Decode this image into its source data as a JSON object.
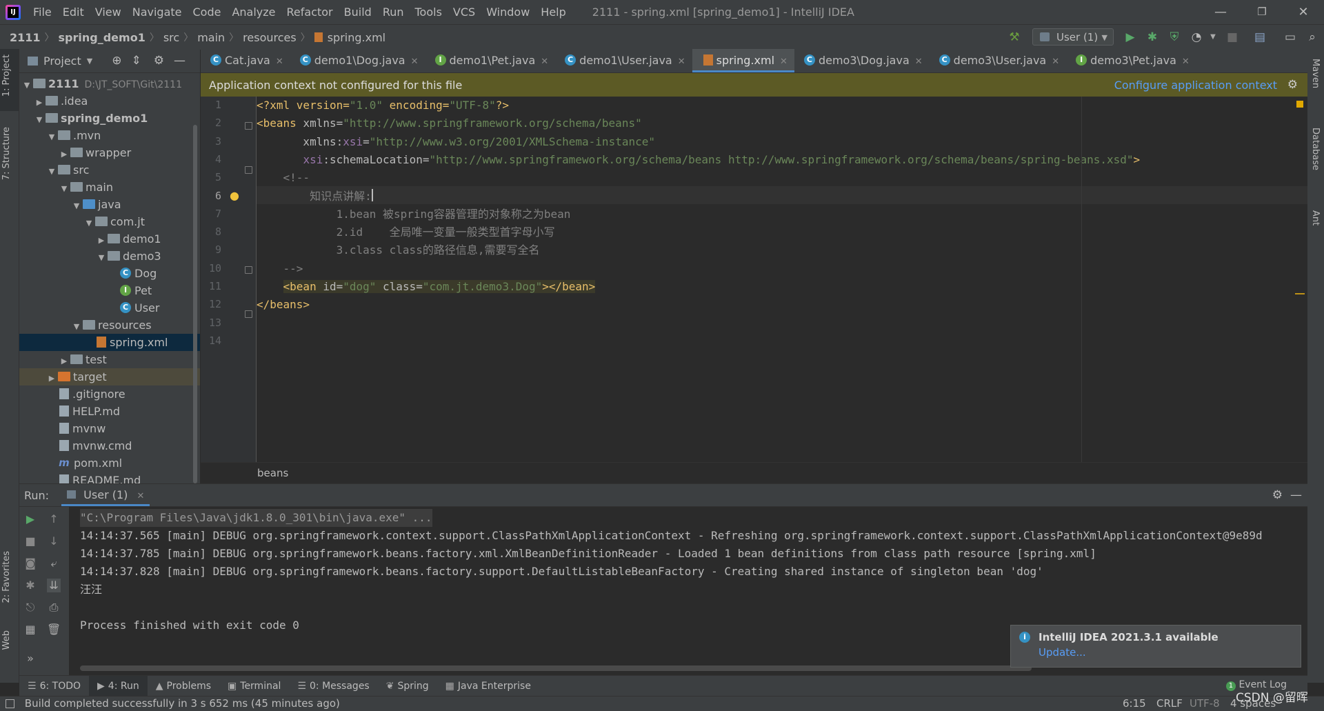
{
  "window": {
    "title": "2111 - spring.xml [spring_demo1] - IntelliJ IDEA",
    "menu": [
      "File",
      "Edit",
      "View",
      "Navigate",
      "Code",
      "Analyze",
      "Refactor",
      "Build",
      "Run",
      "Tools",
      "VCS",
      "Window",
      "Help"
    ],
    "min_glyph": "—",
    "max_glyph": "❐",
    "close_glyph": "✕"
  },
  "nav": {
    "crumbs": [
      "2111",
      "spring_demo1",
      "src",
      "main",
      "resources",
      "spring.xml"
    ],
    "run_config": "User (1)"
  },
  "left_stripe": {
    "project": "1: Project",
    "structure": "7: Structure",
    "favorites": "2: Favorites",
    "web": "Web"
  },
  "right_stripe": {
    "maven": "Maven",
    "database": "Database",
    "ant": "Ant"
  },
  "project": {
    "title": "Project",
    "tree": [
      {
        "label": "2111",
        "extra": "D:\\JT_SOFT\\Git\\2111",
        "depth": 0,
        "arrow": "▼",
        "icon": "folder",
        "bold": true
      },
      {
        "label": ".idea",
        "depth": 1,
        "arrow": "▶",
        "icon": "folder"
      },
      {
        "label": "spring_demo1",
        "depth": 1,
        "arrow": "▼",
        "icon": "folder",
        "bold": true
      },
      {
        "label": ".mvn",
        "depth": 2,
        "arrow": "▼",
        "icon": "folder"
      },
      {
        "label": "wrapper",
        "depth": 3,
        "arrow": "▶",
        "icon": "folder"
      },
      {
        "label": "src",
        "depth": 2,
        "arrow": "▼",
        "icon": "folder"
      },
      {
        "label": "main",
        "depth": 3,
        "arrow": "▼",
        "icon": "folder"
      },
      {
        "label": "java",
        "depth": 4,
        "arrow": "▼",
        "icon": "folder-blue"
      },
      {
        "label": "com.jt",
        "depth": 5,
        "arrow": "▼",
        "icon": "folder"
      },
      {
        "label": "demo1",
        "depth": 6,
        "arrow": "▶",
        "icon": "folder"
      },
      {
        "label": "demo3",
        "depth": 6,
        "arrow": "▼",
        "icon": "folder"
      },
      {
        "label": "Dog",
        "depth": 7,
        "arrow": "",
        "icon": "class-c"
      },
      {
        "label": "Pet",
        "depth": 7,
        "arrow": "",
        "icon": "class-i"
      },
      {
        "label": "User",
        "depth": 7,
        "arrow": "",
        "icon": "class-c"
      },
      {
        "label": "resources",
        "depth": 4,
        "arrow": "▼",
        "icon": "folder"
      },
      {
        "label": "spring.xml",
        "depth": 5,
        "arrow": "",
        "icon": "file-xml",
        "selected": true
      },
      {
        "label": "test",
        "depth": 3,
        "arrow": "▶",
        "icon": "folder"
      },
      {
        "label": "target",
        "depth": 2,
        "arrow": "▶",
        "icon": "folder-orange",
        "target": true
      },
      {
        "label": ".gitignore",
        "depth": 2,
        "arrow": "",
        "icon": "file"
      },
      {
        "label": "HELP.md",
        "depth": 2,
        "arrow": "",
        "icon": "file"
      },
      {
        "label": "mvnw",
        "depth": 2,
        "arrow": "",
        "icon": "file"
      },
      {
        "label": "mvnw.cmd",
        "depth": 2,
        "arrow": "",
        "icon": "file"
      },
      {
        "label": "pom.xml",
        "depth": 2,
        "arrow": "",
        "icon": "maven"
      },
      {
        "label": "README.md",
        "depth": 2,
        "arrow": "",
        "icon": "file"
      }
    ]
  },
  "tabs": [
    {
      "label": "Cat.java",
      "icon": "class-c"
    },
    {
      "label": "demo1\\Dog.java",
      "icon": "class-c"
    },
    {
      "label": "demo1\\Pet.java",
      "icon": "class-i"
    },
    {
      "label": "demo1\\User.java",
      "icon": "class-c"
    },
    {
      "label": "spring.xml",
      "icon": "file-xml",
      "active": true
    },
    {
      "label": "demo3\\Dog.java",
      "icon": "class-c"
    },
    {
      "label": "demo3\\User.java",
      "icon": "class-c"
    },
    {
      "label": "demo3\\Pet.java",
      "icon": "class-i"
    }
  ],
  "banner": {
    "message": "Application context not configured for this file",
    "link": "Configure application context"
  },
  "editor": {
    "line_numbers": [
      "1",
      "2",
      "3",
      "4",
      "5",
      "6",
      "7",
      "8",
      "9",
      "10",
      "11",
      "12",
      "13",
      "14"
    ],
    "lines": [
      [
        {
          "t": "<?xml version=",
          "c": "t-tag"
        },
        {
          "t": "\"1.0\"",
          "c": "t-val"
        },
        {
          "t": " encoding=",
          "c": "t-tag"
        },
        {
          "t": "\"UTF-8\"",
          "c": "t-val"
        },
        {
          "t": "?>",
          "c": "t-tag"
        }
      ],
      [
        {
          "t": "<beans ",
          "c": "t-tag"
        },
        {
          "t": "xmlns=",
          "c": "t-attr"
        },
        {
          "t": "\"http://www.springframework.org/schema/beans\"",
          "c": "t-val"
        }
      ],
      [
        {
          "t": "       xmlns:",
          "c": "t-attr"
        },
        {
          "t": "xsi",
          "c": "t-ns"
        },
        {
          "t": "=",
          "c": "t-attr"
        },
        {
          "t": "\"http://www.w3.org/2001/XMLSchema-instance\"",
          "c": "t-val"
        }
      ],
      [
        {
          "t": "       ",
          "c": ""
        },
        {
          "t": "xsi",
          "c": "t-ns"
        },
        {
          "t": ":schemaLocation=",
          "c": "t-attr"
        },
        {
          "t": "\"http://www.springframework.org/schema/beans http://www.springframework.org/schema/beans/spring-beans.xsd\"",
          "c": "t-val"
        },
        {
          "t": ">",
          "c": "t-tag"
        }
      ],
      [
        {
          "t": "    <!--",
          "c": "t-cmt"
        }
      ],
      [
        {
          "t": "        知识点讲解:",
          "c": "t-cmt"
        }
      ],
      [
        {
          "t": "            1.bean 被spring容器管理的对象称之为bean",
          "c": "t-cmt"
        }
      ],
      [
        {
          "t": "            2.id    全局唯一变量一般类型首字母小写",
          "c": "t-cmt"
        }
      ],
      [
        {
          "t": "            3.class class的路径信息,需要写全名",
          "c": "t-cmt"
        }
      ],
      [
        {
          "t": "    -->",
          "c": "t-cmt"
        }
      ],
      [
        {
          "t": "    ",
          "c": ""
        },
        {
          "t": "<bean ",
          "c": "t-tag hl"
        },
        {
          "t": "id=",
          "c": "t-attr hl"
        },
        {
          "t": "\"dog\"",
          "c": "t-val hl"
        },
        {
          "t": " class=",
          "c": "t-attr hl"
        },
        {
          "t": "\"com.jt.demo3.Dog\"",
          "c": "t-val hl"
        },
        {
          "t": "></bean>",
          "c": "t-tag hl"
        }
      ],
      [
        {
          "t": "</beans>",
          "c": "t-tag"
        }
      ],
      [],
      []
    ],
    "bottom_crumb": "beans"
  },
  "run": {
    "label": "Run:",
    "tab": "User (1)",
    "console": [
      {
        "text": "\"C:\\Program Files\\Java\\jdk1.8.0_301\\bin\\java.exe\" ...",
        "cmd": true
      },
      {
        "text": "14:14:37.565 [main] DEBUG org.springframework.context.support.ClassPathXmlApplicationContext - Refreshing org.springframework.context.support.ClassPathXmlApplicationContext@9e89d"
      },
      {
        "text": "14:14:37.785 [main] DEBUG org.springframework.beans.factory.xml.XmlBeanDefinitionReader - Loaded 1 bean definitions from class path resource [spring.xml]"
      },
      {
        "text": "14:14:37.828 [main] DEBUG org.springframework.beans.factory.support.DefaultListableBeanFactory - Creating shared instance of singleton bean 'dog'"
      },
      {
        "text": "汪汪"
      },
      {
        "text": ""
      },
      {
        "text": "Process finished with exit code 0"
      }
    ]
  },
  "notification": {
    "title": "IntelliJ IDEA 2021.3.1 available",
    "link": "Update..."
  },
  "tool_tabs": [
    {
      "label": "6: TODO",
      "icon": "☰"
    },
    {
      "label": "4: Run",
      "icon": "▶",
      "active": true
    },
    {
      "label": "Problems",
      "icon": "▲"
    },
    {
      "label": "Terminal",
      "icon": "▣"
    },
    {
      "label": "0: Messages",
      "icon": "☰"
    },
    {
      "label": "Spring",
      "icon": "❦"
    },
    {
      "label": "Java Enterprise",
      "icon": "▦"
    }
  ],
  "event_log": "Event Log",
  "event_count": "1",
  "status": {
    "message": "Build completed successfully in 3 s 652 ms (45 minutes ago)",
    "position": "6:15",
    "line_sep": "CRLF",
    "encoding": "UTF-8",
    "indent": "4 spaces",
    "watermark": "CSDN @留晖"
  },
  "colors": {
    "accent": "#4a88c7",
    "banner": "#5c5a25",
    "link": "#589df6",
    "selection": "#0d293e"
  }
}
